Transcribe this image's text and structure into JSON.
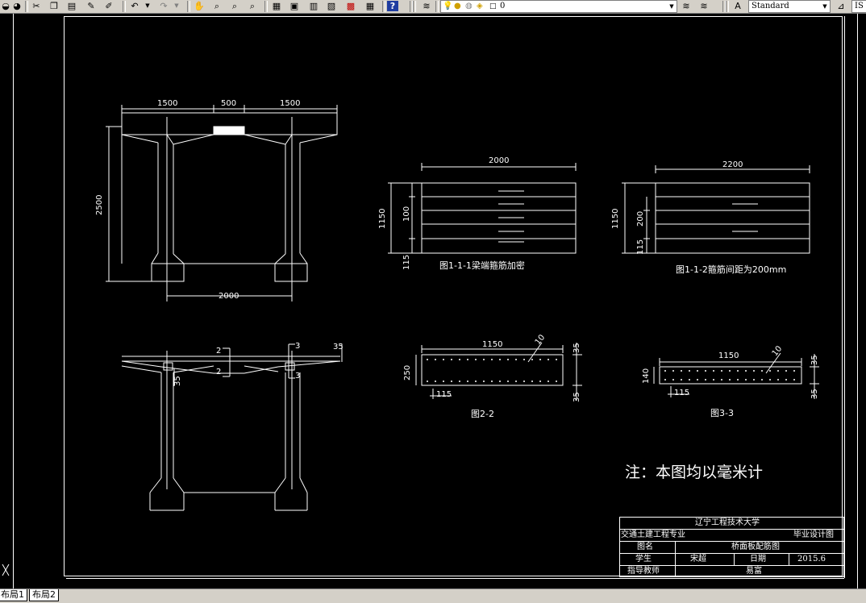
{
  "toolbar": {
    "layer_value": "0",
    "text_style_value": "Standard",
    "dim_style_value": "IS",
    "icons": [
      "layer-state-icon",
      "new-icon",
      "open-icon",
      "save-icon",
      "cut-icon",
      "copy-icon",
      "paste-icon",
      "match-properties-icon",
      "undo-icon",
      "redo-icon",
      "pan-icon",
      "zoom-realtime-icon",
      "zoom-window-icon",
      "zoom-previous-icon",
      "properties-icon",
      "design-center-icon",
      "tool-palettes-icon",
      "markup-icon",
      "calculator-icon",
      "help-icon",
      "layer-manager-icon",
      "text-style-icon",
      "dim-style-icon"
    ]
  },
  "drawing": {
    "elevation": {
      "dim_left": "1500",
      "dim_mid": "500",
      "dim_right": "1500",
      "dim_height": "2500",
      "dim_bottom": "2000"
    },
    "section": {
      "label_2_top": "2",
      "label_2_bot": "2",
      "label_3_top": "3",
      "label_3_bot": "3",
      "dim_35_right": "35",
      "dim_35_left": "35"
    },
    "fig111": {
      "dim_top": "2000",
      "dim_1150": "1150",
      "dim_100": "100",
      "dim_115": "115",
      "caption": "图1-1-1梁端箍筋加密"
    },
    "fig112": {
      "dim_top": "2200",
      "dim_1150": "1150",
      "dim_200": "200",
      "dim_115": "115",
      "caption": "图1-1-2箍筋间距为200mm"
    },
    "fig22": {
      "dim_top": "1150",
      "dim_250": "250",
      "dim_35_top": "35",
      "dim_35_bot": "35",
      "dim_115": "115",
      "rebar_mark": "10",
      "caption": "图2-2"
    },
    "fig33": {
      "dim_top": "1150",
      "dim_140": "140",
      "dim_35_top": "35",
      "dim_35_bot": "35",
      "dim_115": "115",
      "rebar_mark": "10",
      "caption": "图3-3"
    },
    "note": "注：本图均以毫米计",
    "title_block": {
      "school": "辽宁工程技术大学",
      "major": "交通土建工程专业",
      "type": "毕业设计图",
      "name_label": "图名",
      "name_value": "桥面板配筋图",
      "student_label": "学生",
      "student_value": "宋超",
      "date_label": "日期",
      "date_value": "2015.6",
      "advisor_label": "指导教师",
      "advisor_value": "易富"
    }
  },
  "tabs": {
    "layout1": "布局1",
    "layout2": "布局2"
  }
}
